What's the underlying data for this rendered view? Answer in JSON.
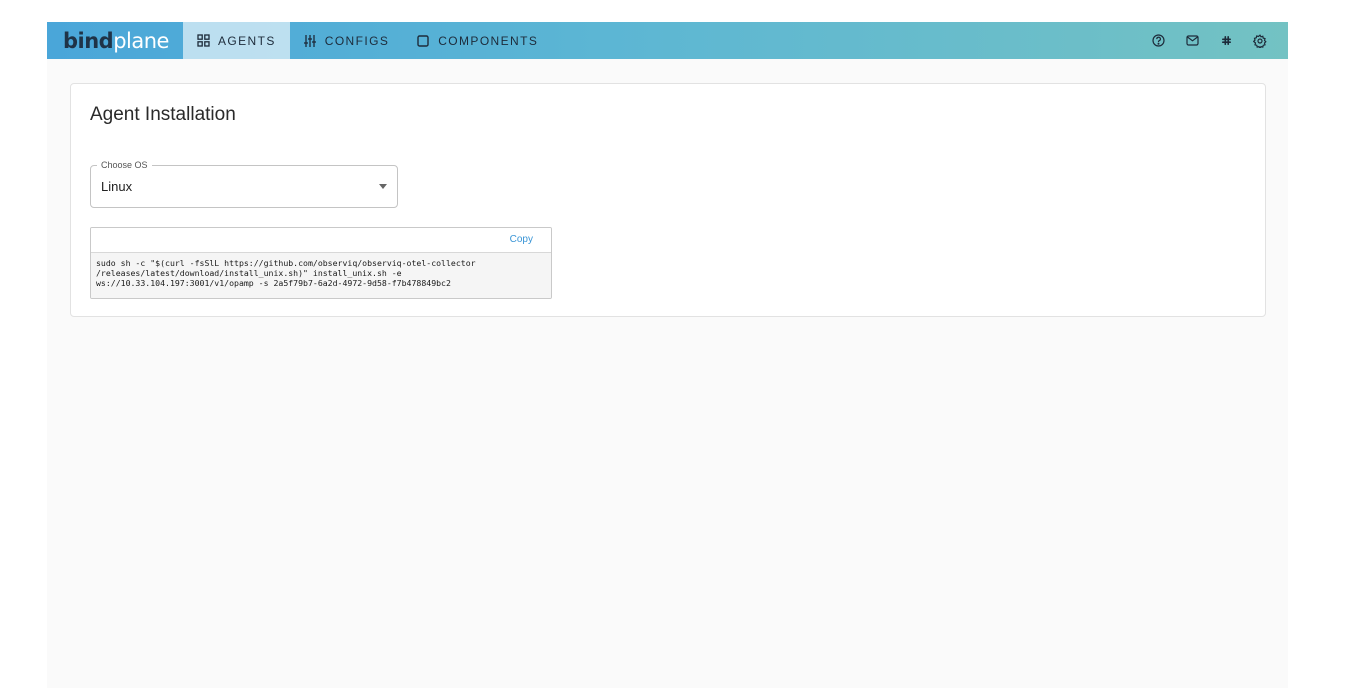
{
  "brand": {
    "part1": "bind",
    "part2": "plane"
  },
  "nav": {
    "tabs": [
      {
        "label": "AGENTS",
        "icon": "grid-icon",
        "active": true
      },
      {
        "label": "CONFIGS",
        "icon": "sliders-icon",
        "active": false
      },
      {
        "label": "COMPONENTS",
        "icon": "square-icon",
        "active": false
      }
    ]
  },
  "top_actions": [
    {
      "icon": "help-circle-icon"
    },
    {
      "icon": "mail-icon"
    },
    {
      "icon": "slack-icon"
    },
    {
      "icon": "gear-icon"
    }
  ],
  "card": {
    "title": "Agent Installation",
    "os_select": {
      "label": "Choose OS",
      "value": "Linux"
    },
    "code": {
      "copy_label": "Copy",
      "lines": [
        "sudo sh -c \"$(curl -fsSlL https://github.com/observiq/observiq-otel-collector",
        "/releases/latest/download/install_unix.sh)\" install_unix.sh -e",
        "ws://10.33.104.197:3001/v1/opamp -s 2a5f79b7-6a2d-4972-9d58-f7b478849bc2"
      ]
    }
  },
  "colors": {
    "topbar_start": "#4aa6d9",
    "topbar_end": "#73c2c3",
    "brand_dark": "#1f3347",
    "link_blue": "#3a95d6"
  }
}
